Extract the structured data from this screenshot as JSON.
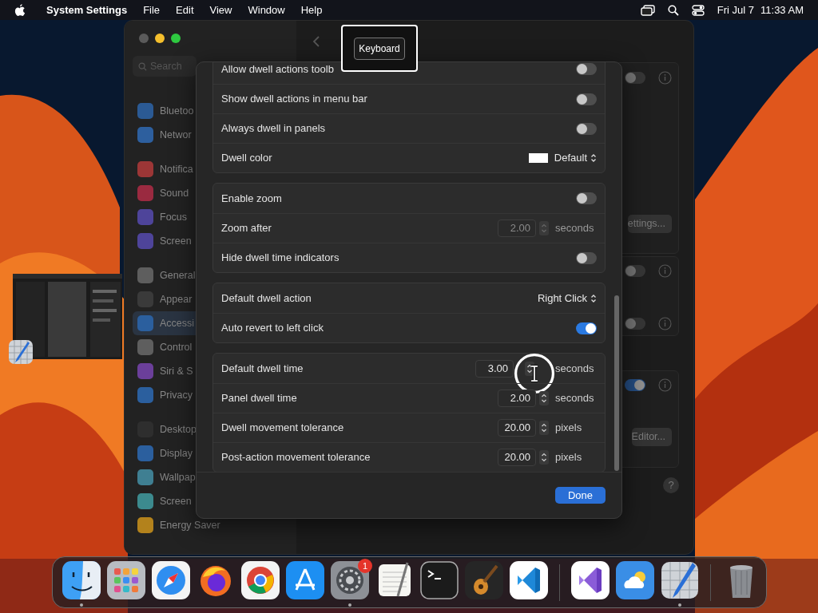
{
  "menu_bar": {
    "app_name": "System Settings",
    "menus": [
      "File",
      "Edit",
      "View",
      "Window",
      "Help"
    ],
    "date": "Fri Jul 7",
    "time": "11:33 AM"
  },
  "settings_window": {
    "search": {
      "placeholder": "Search"
    },
    "sidebar_sections": [
      {
        "items": [
          {
            "label": "Bluetoo",
            "color": "#2b5a94",
            "selected": false
          },
          {
            "label": "Networ",
            "color": "#2d5f9e",
            "selected": false
          }
        ]
      },
      {
        "items": [
          {
            "label": "Notifica",
            "color": "#9c3636",
            "selected": false
          },
          {
            "label": "Sound",
            "color": "#9a2a40",
            "selected": false
          },
          {
            "label": "Focus",
            "color": "#4e449a",
            "selected": false
          },
          {
            "label": "Screen",
            "color": "#4e449a",
            "selected": false
          }
        ]
      },
      {
        "items": [
          {
            "label": "General",
            "color": "#5e5e5e",
            "selected": false
          },
          {
            "label": "Appear",
            "color": "#3a3a3a",
            "selected": false
          },
          {
            "label": "Accessi",
            "color": "#2b5f9e",
            "selected": true
          },
          {
            "label": "Control",
            "color": "#5e5e5e",
            "selected": false
          },
          {
            "label": "Siri & S",
            "color": "#6b3f9a",
            "selected": false
          },
          {
            "label": "Privacy",
            "color": "#2b5f9e",
            "selected": false
          }
        ]
      },
      {
        "items": [
          {
            "label": "Desktop",
            "color": "#2e2e2e",
            "selected": false
          },
          {
            "label": "Display",
            "color": "#2b5f9e",
            "selected": false
          },
          {
            "label": "Wallpap",
            "color": "#3f7f92",
            "selected": false
          },
          {
            "label": "Screen",
            "color": "#3c8a8e",
            "selected": false
          },
          {
            "label": "Energy Saver",
            "color": "#b3821c",
            "selected": false
          }
        ]
      }
    ],
    "background_toggles": [
      {
        "on": false
      },
      {
        "on": false
      },
      {
        "on": false
      },
      {
        "on": true
      }
    ],
    "buttons": [
      "ettings...",
      "Editor..."
    ],
    "help": "?"
  },
  "tooltip": {
    "text": "Keyboard"
  },
  "sheet": {
    "groups": [
      {
        "rows": [
          {
            "kind": "toggle",
            "label": "Allow dwell actions toolb",
            "on": false
          },
          {
            "kind": "toggle",
            "label": "Show dwell actions in menu bar",
            "on": false
          },
          {
            "kind": "toggle",
            "label": "Always dwell in panels",
            "on": false
          },
          {
            "kind": "color_popup",
            "label": "Dwell color",
            "value": "Default"
          }
        ]
      },
      {
        "rows": [
          {
            "kind": "toggle",
            "label": "Enable zoom",
            "on": false
          },
          {
            "kind": "stepper",
            "label": "Zoom after",
            "value": "2.00",
            "unit": "seconds",
            "disabled": true
          },
          {
            "kind": "toggle",
            "label": "Hide dwell time indicators",
            "on": false
          }
        ]
      },
      {
        "rows": [
          {
            "kind": "popup",
            "label": "Default dwell action",
            "value": "Right Click"
          },
          {
            "kind": "toggle",
            "label": "Auto revert to left click",
            "on": true
          }
        ]
      },
      {
        "rows": [
          {
            "kind": "stepper",
            "label": "Default dwell time",
            "value": "3.00",
            "unit": "seconds",
            "disabled": false,
            "pointer": true
          },
          {
            "kind": "stepper",
            "label": "Panel dwell time",
            "value": "2.00",
            "unit": "seconds",
            "disabled": false
          },
          {
            "kind": "stepper",
            "label": "Dwell movement tolerance",
            "value": "20.00",
            "unit": "pixels",
            "disabled": false
          },
          {
            "kind": "stepper",
            "label": "Post-action movement tolerance",
            "value": "20.00",
            "unit": "pixels",
            "disabled": false
          }
        ]
      }
    ],
    "done_button": "Done"
  },
  "dock": {
    "items": [
      {
        "kind": "finder",
        "running": true
      },
      {
        "kind": "launchpad",
        "running": false
      },
      {
        "kind": "safari",
        "running": false
      },
      {
        "kind": "firefox",
        "running": false
      },
      {
        "kind": "chrome",
        "running": false
      },
      {
        "kind": "appstore",
        "running": false
      },
      {
        "kind": "settings",
        "running": true,
        "badge": "1"
      },
      {
        "kind": "textedit",
        "running": false
      },
      {
        "kind": "terminal",
        "running": false
      },
      {
        "kind": "garageband",
        "running": false
      },
      {
        "kind": "vscode",
        "running": false
      },
      {
        "kind": "divider"
      },
      {
        "kind": "visualstudio",
        "running": false
      },
      {
        "kind": "weather",
        "running": false
      },
      {
        "kind": "freeform",
        "running": true
      },
      {
        "kind": "divider"
      },
      {
        "kind": "trash",
        "running": false
      }
    ]
  }
}
